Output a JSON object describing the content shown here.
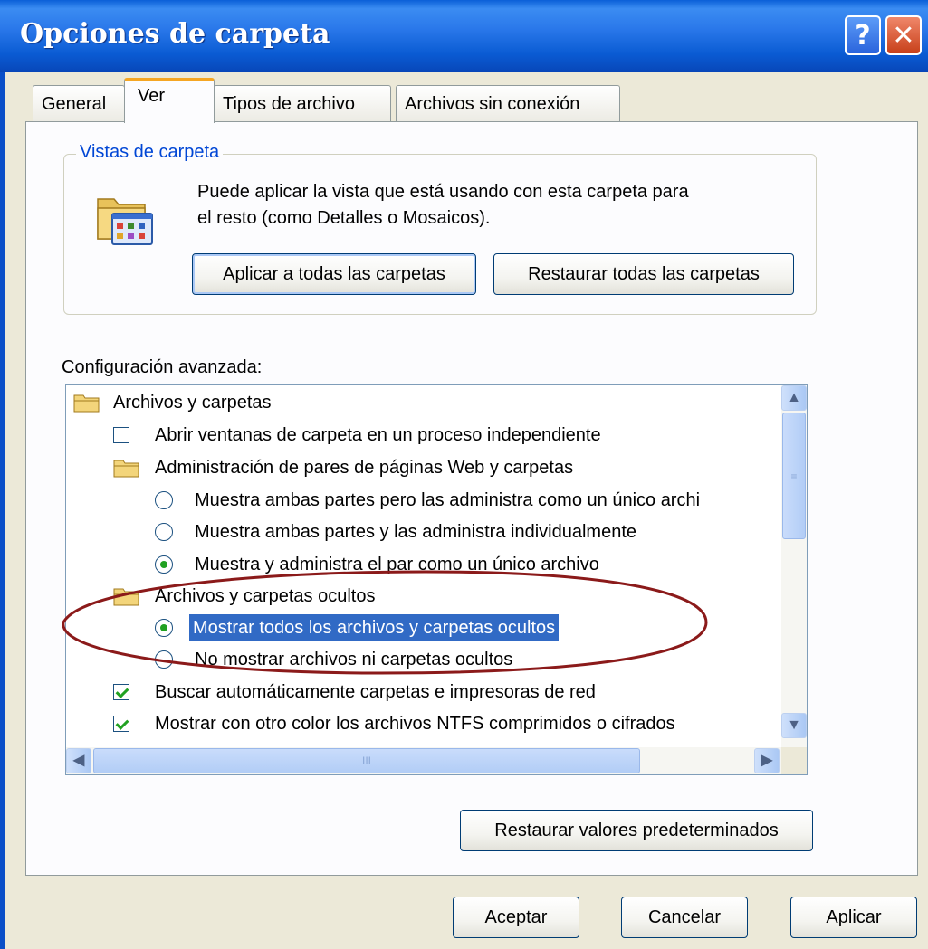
{
  "window": {
    "title": "Opciones de carpeta",
    "help_symbol": "?",
    "close_symbol": "✕"
  },
  "tabs": [
    {
      "label": "General"
    },
    {
      "label": "Ver"
    },
    {
      "label": "Tipos de archivo"
    },
    {
      "label": "Archivos sin conexión"
    }
  ],
  "folder_views": {
    "legend": "Vistas de carpeta",
    "description_line1": "Puede aplicar la vista que está usando con esta carpeta para",
    "description_line2": "el resto (como Detalles o Mosaicos).",
    "apply_all_label": "Aplicar a todas las carpetas",
    "reset_all_label": "Restaurar todas las carpetas"
  },
  "advanced": {
    "label": "Configuración avanzada:",
    "items": [
      {
        "type": "folder",
        "level": 0,
        "label": "Archivos y carpetas"
      },
      {
        "type": "checkbox",
        "level": 1,
        "checked": false,
        "label": "Abrir ventanas de carpeta  en un proceso independiente"
      },
      {
        "type": "folder",
        "level": 1,
        "label": "Administración de pares de páginas Web y carpetas"
      },
      {
        "type": "radio",
        "level": 2,
        "checked": false,
        "label": "Muestra ambas partes pero las administra como un único archi"
      },
      {
        "type": "radio",
        "level": 2,
        "checked": false,
        "label": "Muestra ambas partes y las administra individualmente"
      },
      {
        "type": "radio",
        "level": 2,
        "checked": true,
        "label": "Muestra y administra el par como un único archivo"
      },
      {
        "type": "folder",
        "level": 1,
        "label": "Archivos y carpetas ocultos"
      },
      {
        "type": "radio",
        "level": 2,
        "checked": true,
        "selected": true,
        "label": "Mostrar todos los archivos y carpetas ocultos"
      },
      {
        "type": "radio",
        "level": 2,
        "checked": false,
        "label": "No mostrar archivos ni carpetas ocultos"
      },
      {
        "type": "checkbox",
        "level": 1,
        "checked": true,
        "label": "Buscar automáticamente carpetas e impresoras de red"
      },
      {
        "type": "checkbox",
        "level": 1,
        "checked": true,
        "label": "Mostrar con otro color los archivos NTFS comprimidos o cifrados"
      }
    ],
    "scroll": {
      "up": "▲",
      "down": "▼",
      "left": "◀",
      "right": "▶",
      "thumb_grip_v": "≡",
      "thumb_grip_h": "III"
    }
  },
  "footer": {
    "restore_defaults_label": "Restaurar valores predeterminados",
    "ok_label": "Aceptar",
    "cancel_label": "Cancelar",
    "apply_label": "Aplicar"
  },
  "colors": {
    "title_bar": "#0a5bd3",
    "dialog_bg": "#ece9d8",
    "panel_bg": "#fcfcfe",
    "selection": "#316ac5",
    "active_tab_accent": "#f5a623",
    "annotation_ellipse": "#8b1a1a",
    "check_green": "#21a121"
  }
}
